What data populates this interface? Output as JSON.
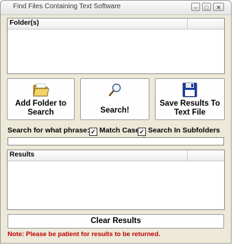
{
  "window": {
    "title": "Find Files Containing Text Software",
    "minimize_symbol": "–",
    "maximize_symbol": "□",
    "close_symbol": "✕"
  },
  "folders": {
    "header": "Folder(s)"
  },
  "buttons": {
    "add_folder": "Add Folder to\nSearch",
    "search": "Search!",
    "save_results": "Save Results To\nText File",
    "clear_results": "Clear Results"
  },
  "search_options": {
    "phrase_label": "Search for what phrase:",
    "match_case_label": "Match Case",
    "match_case_checked": true,
    "subfolders_label": "Search In Subfolders Also",
    "subfolders_checked": true,
    "check_mark": "✓",
    "phrase_value": ""
  },
  "results": {
    "header": "Results"
  },
  "note": "Note: Please be patient for results to be returned.",
  "colors": {
    "note_text": "#c00000",
    "folder_icon": "#e8c450",
    "floppy_icon": "#1a3f9c"
  },
  "icons": [
    "folder-icon",
    "magnifier-icon",
    "floppy-disk-icon"
  ]
}
